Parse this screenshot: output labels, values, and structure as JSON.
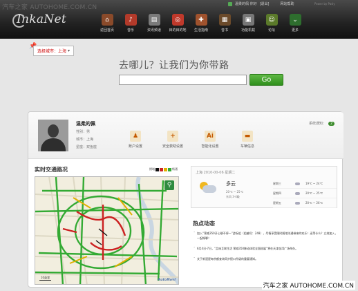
{
  "watermark": {
    "top": "汽车之家 AUTOHOME.COM.CN",
    "bottom": "汽车之家 AUTOHOME.COM.CN"
  },
  "brand": {
    "logo": "InkaNet"
  },
  "userbar": {
    "greeting": "温柔的佩 你好",
    "logout": "[退出]",
    "help": "网站帮助",
    "powered": "Power by Pasly"
  },
  "nav": [
    {
      "label": "返回首页",
      "icon": "home-icon",
      "color": "#8a4a2a",
      "glyph": "⌂"
    },
    {
      "label": "音乐",
      "icon": "music-icon",
      "color": "#b33a2a",
      "glyph": "♪"
    },
    {
      "label": "资讯频道",
      "icon": "news-icon",
      "color": "#7a7a7a",
      "glyph": "▤"
    },
    {
      "label": "目的目的地",
      "icon": "destination-icon",
      "color": "#c0392b",
      "glyph": "◎"
    },
    {
      "label": "生活指南",
      "icon": "life-guide-icon",
      "color": "#a0522d",
      "glyph": "✚"
    },
    {
      "label": "音书",
      "icon": "audiobook-icon",
      "color": "#6b4a2a",
      "glyph": "▦"
    },
    {
      "label": "功能机载",
      "icon": "car-function-icon",
      "color": "#777777",
      "glyph": "▣"
    },
    {
      "label": "论坛",
      "icon": "forum-icon",
      "color": "#5b7a2a",
      "glyph": "☺"
    },
    {
      "label": "更多",
      "icon": "more-icon",
      "color": "#2e6e2e",
      "glyph": "⌄"
    }
  ],
  "city": {
    "label": "选择城市：上海",
    "chevron": "▾"
  },
  "hero": {
    "title": "去哪儿？让我们为你带路"
  },
  "search": {
    "value": "",
    "placeholder": "",
    "go": "Go"
  },
  "profile": {
    "name": "温柔的佩",
    "gender": "性别：男",
    "city": "城市：上海",
    "constellation": "星座：双鱼座"
  },
  "actions": [
    {
      "label": "账户设置",
      "icon": "account-settings-icon",
      "glyph": "♟"
    },
    {
      "label": "安全救助设置",
      "icon": "safety-rescue-icon",
      "glyph": "+"
    },
    {
      "label": "智能化设置",
      "icon": "smart-settings-icon",
      "glyph": "Ai"
    },
    {
      "label": "车辆信息",
      "icon": "vehicle-info-icon",
      "glyph": "▬"
    }
  ],
  "sysmsg": {
    "label": "系统通知：",
    "count": "2"
  },
  "traffic": {
    "title": "实时交通路况",
    "legend_slow": "拥堵",
    "legend_fast": "畅通",
    "colors": [
      "#111111",
      "#cc2222",
      "#e0b000",
      "#33aa33"
    ],
    "scale": "10英里",
    "map_brand": "AutoNavi"
  },
  "weather": {
    "date": "上海  2010-00-06 星期二",
    "desc": "多云",
    "temp": "20℃ ~ 25℃",
    "wind": "东风 3-4级",
    "forecast": [
      {
        "day": "星期三",
        "temp": "19℃ ~ 24℃"
      },
      {
        "day": "星期四",
        "temp": "20℃ ~ 25℃"
      },
      {
        "day": "星期五",
        "temp": "20℃ ~ 26℃"
      }
    ]
  },
  "news": {
    "title": "热点动态",
    "items": [
      "加入“荣威350开心聊不停一”游拆组（组编号：248），尽情享受随时随地沟通带来的欢乐！还等什么？立刻加入，一起畅聊！",
      "6月4日-7日，“品味互联生活 荣威350移动体验全国巡展”将在天津金湾广场举办。",
      "关于新速星每余额查询同步接口升级的重要通知。"
    ]
  }
}
